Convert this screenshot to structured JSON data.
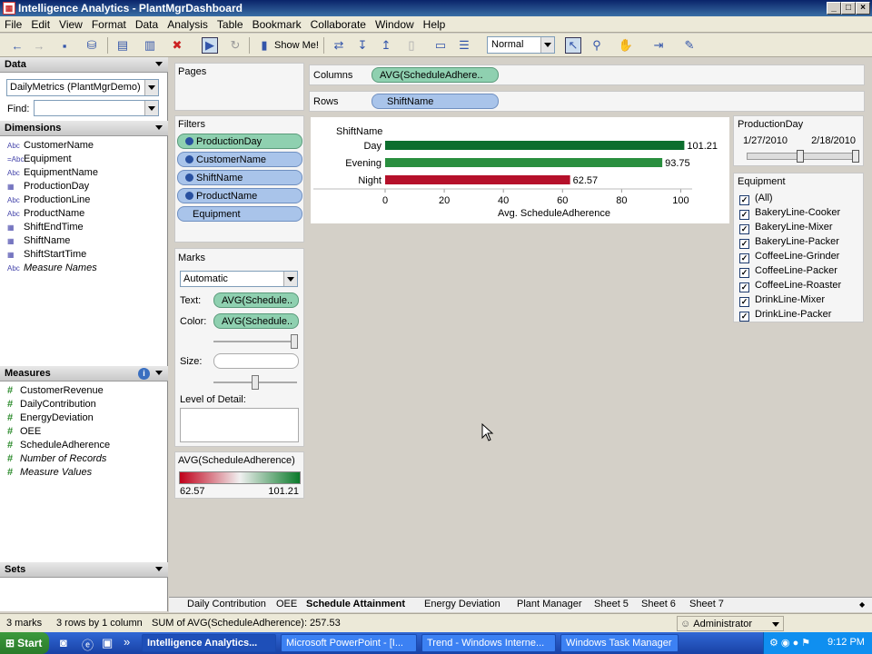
{
  "window": {
    "title": "Intelligence Analytics - PlantMgrDashboard"
  },
  "menu": [
    "File",
    "Edit",
    "View",
    "Format",
    "Data",
    "Analysis",
    "Table",
    "Bookmark",
    "Collaborate",
    "Window",
    "Help"
  ],
  "toolbar": {
    "show_me": "Show Me!",
    "fit": "Normal"
  },
  "data_panel": {
    "header": "Data",
    "source": "DailyMetrics (PlantMgrDemo)",
    "find_label": "Find:",
    "find_value": ""
  },
  "dimensions": {
    "header": "Dimensions",
    "items": [
      {
        "icon": "Abc",
        "label": "CustomerName"
      },
      {
        "icon": "=Abc",
        "label": "Equipment"
      },
      {
        "icon": "Abc",
        "label": "EquipmentName"
      },
      {
        "icon": "date",
        "label": "ProductionDay"
      },
      {
        "icon": "Abc",
        "label": "ProductionLine"
      },
      {
        "icon": "Abc",
        "label": "ProductName"
      },
      {
        "icon": "date",
        "label": "ShiftEndTime"
      },
      {
        "icon": "date",
        "label": "ShiftName"
      },
      {
        "icon": "date",
        "label": "ShiftStartTime"
      },
      {
        "icon": "Abc",
        "label": "Measure Names"
      }
    ]
  },
  "measures": {
    "header": "Measures",
    "items": [
      "CustomerRevenue",
      "DailyContribution",
      "EnergyDeviation",
      "OEE",
      "ScheduleAdherence",
      "Number of Records",
      "Measure Values"
    ]
  },
  "sets": {
    "header": "Sets"
  },
  "pages": {
    "title": "Pages"
  },
  "filters": {
    "title": "Filters",
    "items": [
      "ProductionDay",
      "CustomerName",
      "ShiftName",
      "ProductName",
      "Equipment"
    ]
  },
  "marks": {
    "title": "Marks",
    "type": "Automatic",
    "text_label": "Text:",
    "text_pill": "AVG(Schedule..",
    "color_label": "Color:",
    "color_pill": "AVG(Schedule..",
    "size_label": "Size:",
    "lod_label": "Level of Detail:"
  },
  "legend": {
    "title": "AVG(ScheduleAdherence)",
    "min": "62.57",
    "max": "101.21",
    "low_color": "#c0001a",
    "high_color": "#0a7a2a"
  },
  "columns": {
    "label": "Columns",
    "pill": "AVG(ScheduleAdhere.."
  },
  "rows": {
    "label": "Rows",
    "pill": "ShiftName"
  },
  "chart_data": {
    "type": "bar",
    "orientation": "horizontal",
    "row_header": "ShiftName",
    "categories": [
      "Day",
      "Evening",
      "Night"
    ],
    "values": [
      101.21,
      93.75,
      62.57
    ],
    "value_labels": [
      "101.21",
      "93.75",
      "62.57"
    ],
    "colors": [
      "#0d6e2e",
      "#2a8f3f",
      "#b5102a"
    ],
    "xlabel": "Avg. ScheduleAdherence",
    "xlim": [
      0,
      110
    ],
    "xticks": [
      "0",
      "20",
      "40",
      "60",
      "80",
      "100"
    ],
    "grid": false
  },
  "production_day": {
    "title": "ProductionDay",
    "start": "1/27/2010",
    "end": "2/18/2010"
  },
  "equipment": {
    "title": "Equipment",
    "items": [
      "(All)",
      "BakeryLine-Cooker",
      "BakeryLine-Mixer",
      "BakeryLine-Packer",
      "CoffeeLine-Grinder",
      "CoffeeLine-Packer",
      "CoffeeLine-Roaster",
      "DrinkLine-Mixer",
      "DrinkLine-Packer"
    ]
  },
  "tabs": [
    {
      "label": "Daily Contribution",
      "selected": false
    },
    {
      "label": "OEE",
      "selected": false
    },
    {
      "label": "Schedule Attainment",
      "selected": true
    },
    {
      "label": "Energy Deviation",
      "selected": false
    },
    {
      "label": "Plant Manager",
      "selected": false
    },
    {
      "label": "Sheet 5",
      "selected": false
    },
    {
      "label": "Sheet 6",
      "selected": false
    },
    {
      "label": "Sheet 7",
      "selected": false
    }
  ],
  "status": {
    "marks": "3 marks",
    "dims": "3 rows by 1 column",
    "sum": "SUM of AVG(ScheduleAdherence): 257.53",
    "user": "Administrator"
  },
  "taskbar": {
    "start": "Start",
    "tasks": [
      "Intelligence Analytics...",
      "Microsoft PowerPoint - [I...",
      "Trend - Windows Interne...",
      "Windows Task Manager"
    ],
    "clock": "9:12 PM"
  }
}
